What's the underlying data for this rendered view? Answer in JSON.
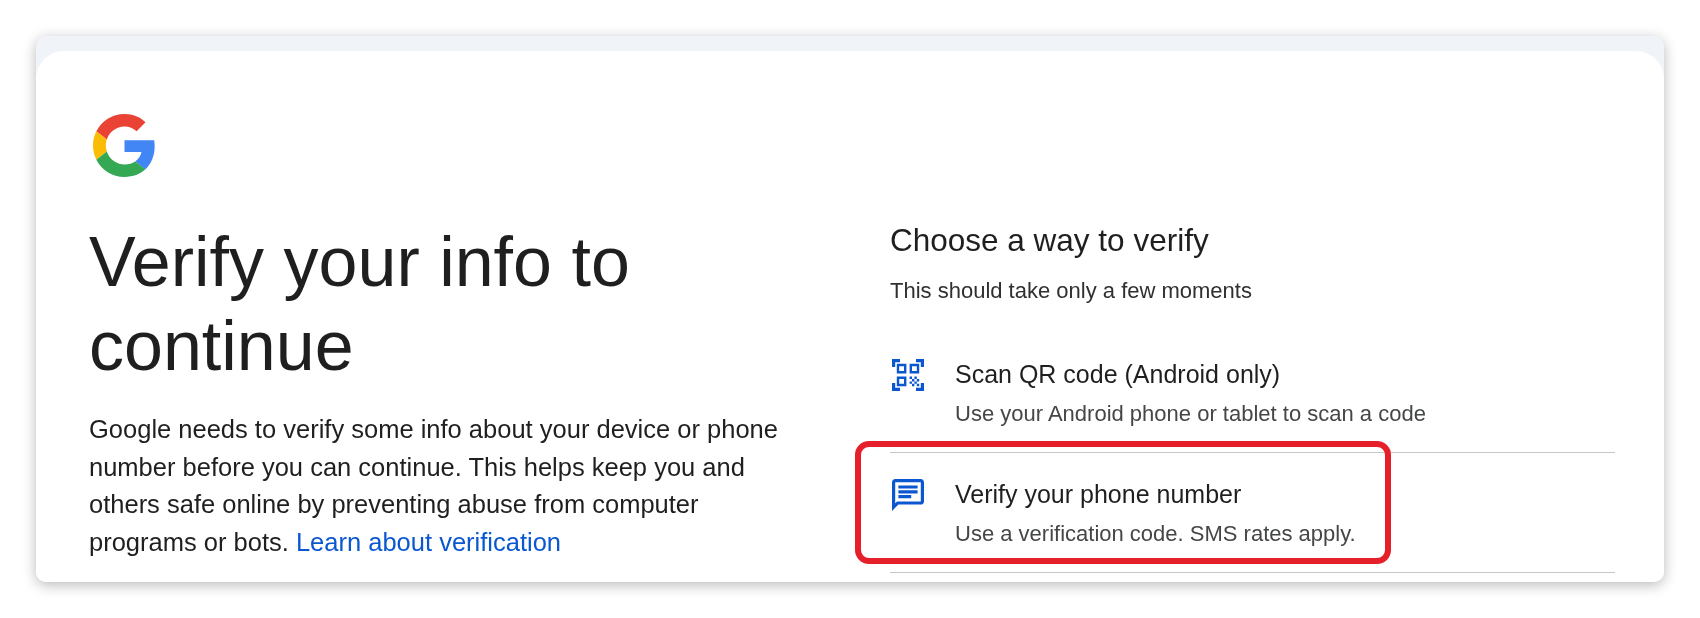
{
  "heading": "Verify your info to continue",
  "description": {
    "text": "Google needs to verify some info about your device or phone number before you can continue. This helps keep you and others safe online by preventing abuse from computer programs or bots.",
    "link": "Learn about verification"
  },
  "verification": {
    "title": "Choose a way to verify",
    "subtitle": "This should take only a few moments",
    "options": [
      {
        "kind": "qr",
        "title": "Scan QR code (Android only)",
        "description": "Use your Android phone or tablet to scan a code",
        "highlighted": false
      },
      {
        "kind": "sms",
        "title": "Verify your phone number",
        "description": "Use a verification code. SMS rates apply.",
        "highlighted": true
      }
    ]
  }
}
